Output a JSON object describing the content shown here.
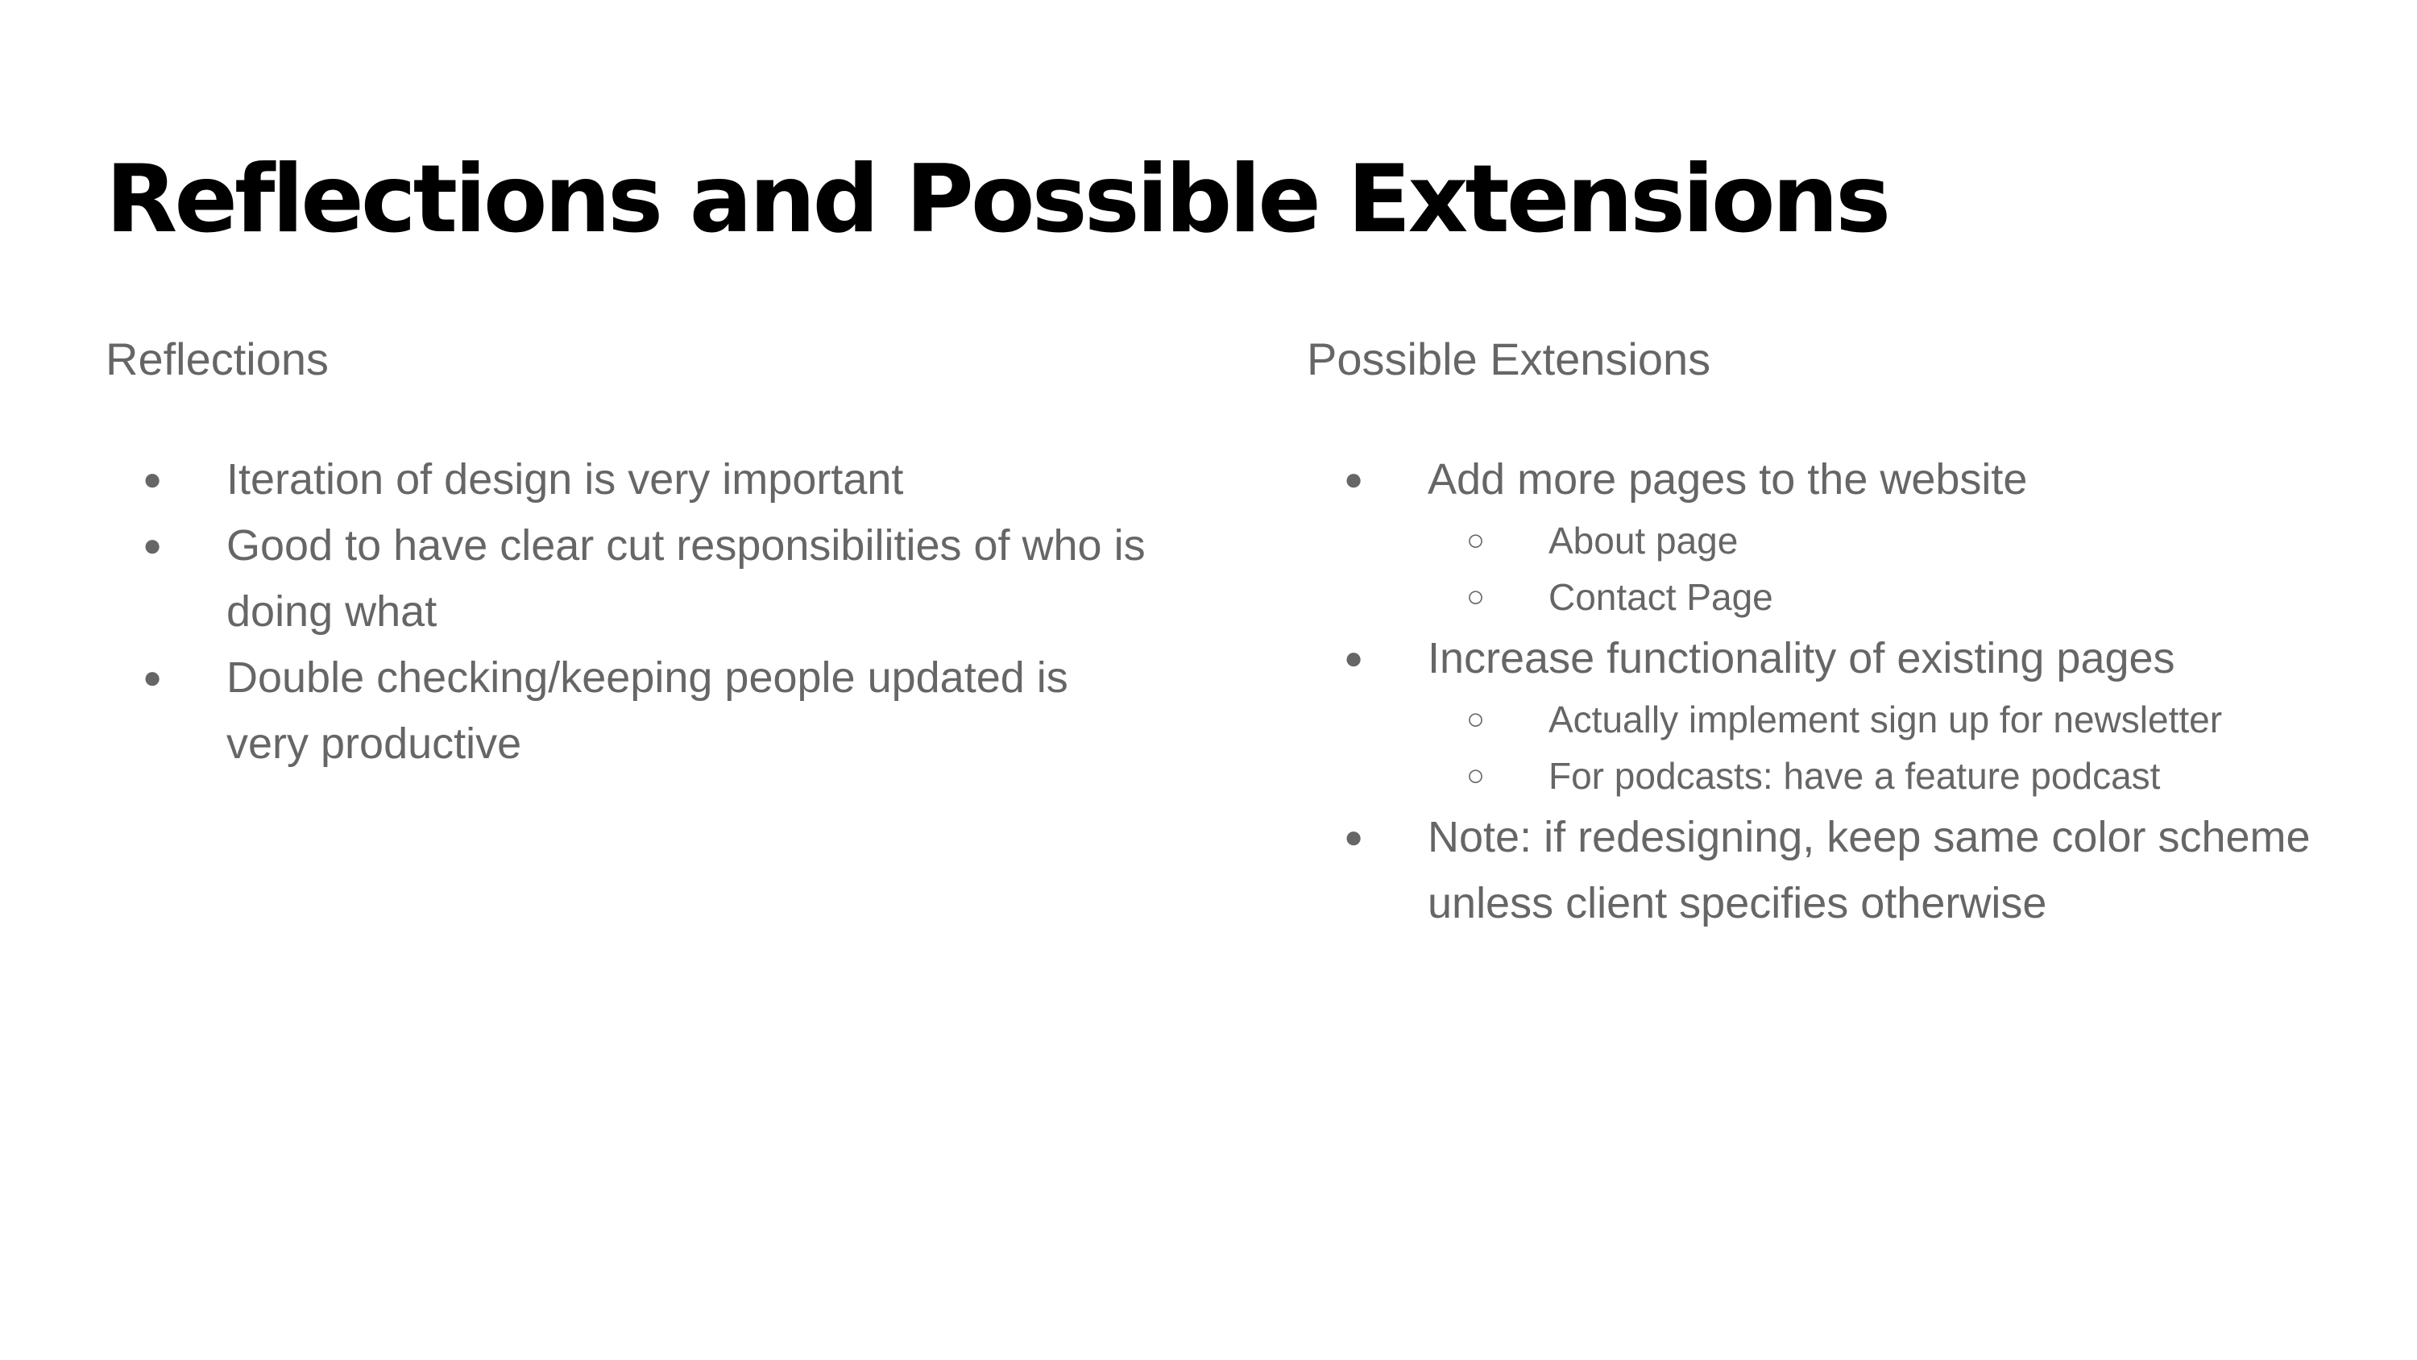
{
  "title": "Reflections and Possible Extensions",
  "left_column": {
    "heading": "Reflections",
    "items": [
      "Iteration of design is very important",
      "Good to have clear cut responsibilities of who is doing what",
      "Double checking/keeping people updated is very productive"
    ]
  },
  "right_column": {
    "heading": "Possible Extensions",
    "items": [
      {
        "text": "Add more pages to the website",
        "subitems": [
          "About page",
          "Contact Page"
        ]
      },
      {
        "text": "Increase functionality of existing pages",
        "subitems": [
          "Actually implement sign up for newsletter",
          "For podcasts: have a feature podcast"
        ]
      },
      {
        "text": "Note: if redesigning, keep same color scheme unless client specifies otherwise",
        "subitems": []
      }
    ]
  },
  "bullet_icons": {
    "level1": "●",
    "level2": "○"
  }
}
